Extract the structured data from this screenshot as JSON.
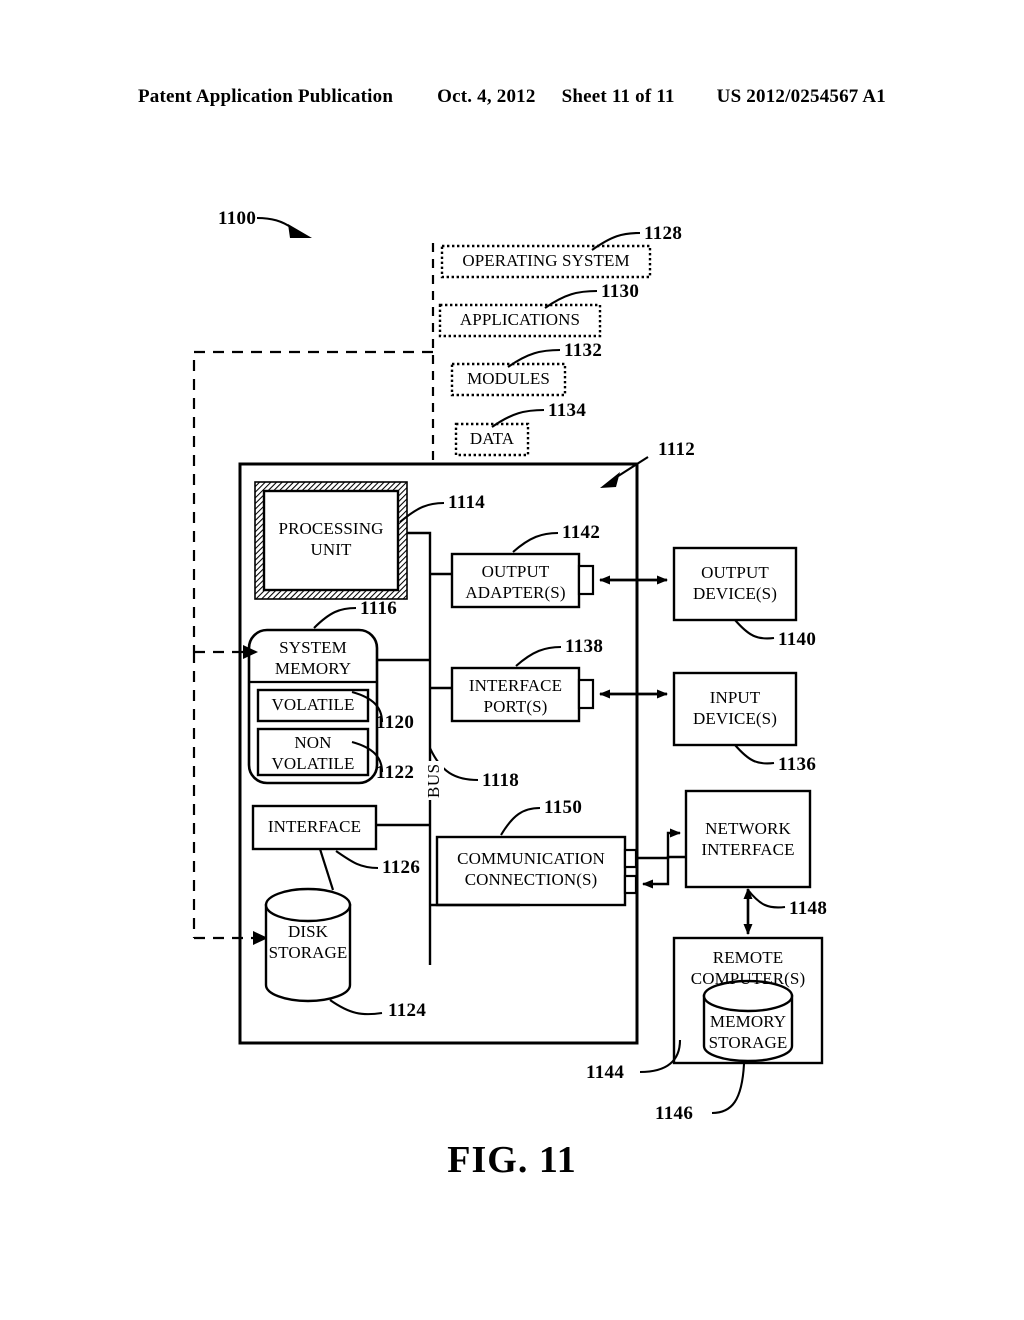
{
  "header": {
    "publication": "Patent Application Publication",
    "date": "Oct. 4, 2012",
    "sheet": "Sheet 11 of 11",
    "number": "US 2012/0254567 A1"
  },
  "figure": {
    "caption": "FIG. 11",
    "system_ref": "1100"
  },
  "software_stack": [
    {
      "label": "OPERATING SYSTEM",
      "ref": "1128"
    },
    {
      "label": "APPLICATIONS",
      "ref": "1130"
    },
    {
      "label": "MODULES",
      "ref": "1132"
    },
    {
      "label": "DATA",
      "ref": "1134"
    }
  ],
  "computer": {
    "ref": "1112",
    "bus_label": "BUS",
    "bus_ref": "1118",
    "blocks": {
      "processing_unit": {
        "label": "PROCESSING\nUNIT",
        "ref": "1114"
      },
      "system_memory": {
        "label": "SYSTEM\nMEMORY",
        "ref": "1116"
      },
      "volatile": {
        "label": "VOLATILE",
        "ref": "1120"
      },
      "non_volatile": {
        "label": "NON\nVOLATILE",
        "ref": "1122"
      },
      "interface": {
        "label": "INTERFACE",
        "ref": "1126"
      },
      "disk_storage": {
        "label": "DISK\nSTORAGE",
        "ref": "1124"
      },
      "output_adapters": {
        "label": "OUTPUT\nADAPTER(S)",
        "ref": "1142"
      },
      "interface_ports": {
        "label": "INTERFACE\nPORT(S)",
        "ref": "1138"
      },
      "communication": {
        "label": "COMMUNICATION\nCONNECTION(S)",
        "ref": "1150"
      }
    }
  },
  "external": {
    "output_devices": {
      "label": "OUTPUT\nDEVICE(S)",
      "ref": "1140"
    },
    "input_devices": {
      "label": "INPUT\nDEVICE(S)",
      "ref": "1136"
    },
    "network_interface": {
      "label": "NETWORK\nINTERFACE",
      "ref": "1148"
    },
    "remote_computers": {
      "label": "REMOTE\nCOMPUTER(S)",
      "ref": "1144"
    },
    "memory_storage": {
      "label": "MEMORY\nSTORAGE",
      "ref": "1146"
    }
  },
  "colors": {
    "ink": "#000000",
    "hatch": "#8a8a8a",
    "paper": "#ffffff"
  }
}
